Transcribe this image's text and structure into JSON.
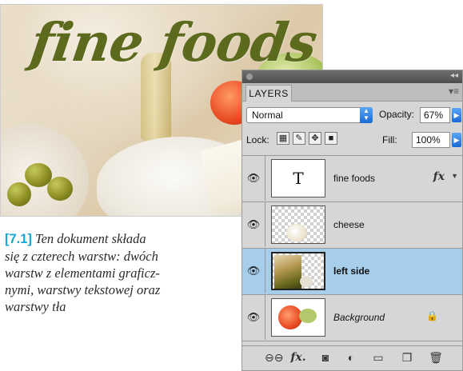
{
  "photo": {
    "title": "fine foods"
  },
  "caption": {
    "number": "[7.1]",
    "lines": [
      "Ten dokument składa",
      "się z czterech warstw: dwóch",
      "warstw z elementami graficz-",
      "nymi, warstwy tekstowej oraz",
      "warstwy tła"
    ]
  },
  "panel": {
    "tab_label": "LAYERS",
    "blend_mode": "Normal",
    "opacity_label": "Opacity:",
    "opacity_value": "67%",
    "lock_label": "Lock:",
    "fill_label": "Fill:",
    "fill_value": "100%",
    "layers": [
      {
        "name": "fine foods",
        "kind": "text",
        "thumb_glyph": "T",
        "fx": "fx",
        "visible": true,
        "selected": false
      },
      {
        "name": "cheese",
        "kind": "image",
        "visible": true,
        "selected": false
      },
      {
        "name": "left side",
        "kind": "image",
        "visible": true,
        "selected": true
      },
      {
        "name": "Background",
        "kind": "background",
        "visible": true,
        "selected": false,
        "locked": true
      }
    ],
    "colors": {
      "selected_row": "#a6cdea",
      "accent_blue": "#1a69d6",
      "caption_number": "#17a6d6"
    }
  }
}
